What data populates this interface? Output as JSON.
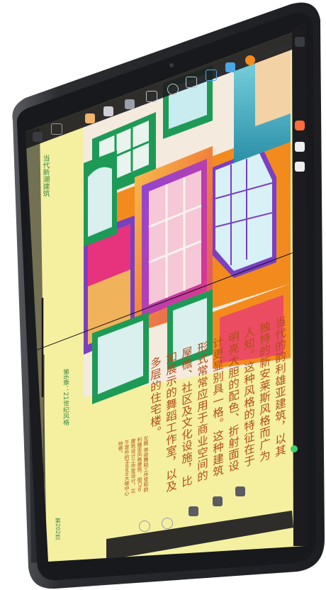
{
  "document": {
    "running_head": "当代新潮建筑",
    "chapter_label": "第6章：21世纪风格",
    "page_number": "第202页",
    "body_paragraph": "当代的韵利雄亚建筑，以其独特的新安莱斯风格而广为人知。这种风格的特征在于明亮大胆的配色、折射面设计更显别具一格。这种建筑形式常常应用于商业空间的屋檐、社区及文化设施，比如展示的舞蹈工作室，以及多层的住宅楼。",
    "caption": "左图 单层舞蹈工作室和韵利雄亚风格建筑，由Cho建筑设计工作室设计。立于室外的Hotelo大楼中心地带。"
  },
  "toolbar": {
    "top_tools": [
      "brush-tool",
      "pen-tool",
      "eraser-tool",
      "selection-tool",
      "crop-tool",
      "shape-tool",
      "transform-tool",
      "text-tool",
      "color-tool"
    ],
    "bottom_tools": [
      "undo",
      "redo",
      "layers",
      "grid",
      "zoom",
      "hand",
      "more"
    ]
  },
  "colors": {
    "page_paper": "#f4f0a0",
    "text_accent": "#b14d17",
    "label_green": "#3c8a4a",
    "device_frame": "#2b2c30",
    "screen_dark": "#1c1c20",
    "active_indicator": "#3ad26a",
    "art_orange": "#f38a1e",
    "art_pink": "#e7327d",
    "art_purple": "#7a3fc2",
    "art_green": "#1e9a57",
    "art_teal": "#3bb6c9"
  }
}
